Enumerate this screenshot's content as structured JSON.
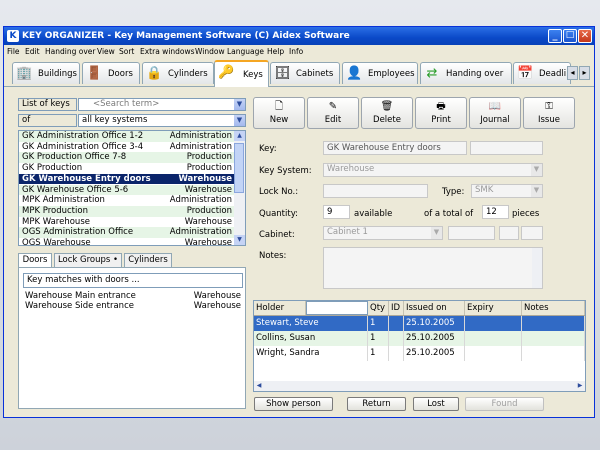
{
  "window": {
    "title": "KEY ORGANIZER  -  Key Management Software   (C) Aidex Software",
    "minimize": "_",
    "maximize": "□",
    "close": "✕"
  },
  "menu": [
    "File",
    "Edit",
    "Handing over",
    "View",
    "Sort",
    "Extra windows",
    "Window",
    "Language",
    "Help",
    "Info"
  ],
  "tabs": [
    {
      "label": "Buildings",
      "icon": "building-icon"
    },
    {
      "label": "Doors",
      "icon": "door-icon"
    },
    {
      "label": "Cylinders",
      "icon": "cylinder-icon"
    },
    {
      "label": "Keys",
      "icon": "key-icon"
    },
    {
      "label": "Cabinets",
      "icon": "cabinet-icon"
    },
    {
      "label": "Employees",
      "icon": "employee-icon"
    },
    {
      "label": "Handing over",
      "icon": "handover-icon"
    },
    {
      "label": "Deadli",
      "icon": "calendar-icon"
    }
  ],
  "active_tab": "Keys",
  "left": {
    "list_of_keys_label": "List of keys",
    "search_placeholder": "<Search term>",
    "of_label": "of",
    "key_system_filter": "all key systems",
    "keys": [
      {
        "name": "GK Administration Office 1-2",
        "system": "Administration"
      },
      {
        "name": "GK Administration Office 3-4",
        "system": "Administration"
      },
      {
        "name": "GK Production Office 7-8",
        "system": "Production"
      },
      {
        "name": "GK Production",
        "system": "Production"
      },
      {
        "name": "GK Warehouse Entry doors",
        "system": "Warehouse"
      },
      {
        "name": "GK Warehouse Office 5-6",
        "system": "Warehouse"
      },
      {
        "name": "MPK Administration",
        "system": "Administration"
      },
      {
        "name": "MPK Production",
        "system": "Production"
      },
      {
        "name": "MPK Warehouse",
        "system": "Warehouse"
      },
      {
        "name": "OGS Administration Office",
        "system": "Administration"
      },
      {
        "name": "OGS Warehouse",
        "system": "Warehouse"
      }
    ],
    "selected_key_index": 4,
    "subtabs": [
      "Doors",
      "Lock Groups •",
      "Cylinders"
    ],
    "door_search_placeholder": "Key matches with doors ...",
    "doors": [
      {
        "name": "Warehouse Main entrance",
        "system": "Warehouse"
      },
      {
        "name": "Warehouse Side entrance",
        "system": "Warehouse"
      }
    ]
  },
  "toolbar": {
    "new": "New",
    "edit": "Edit",
    "delete": "Delete",
    "print": "Print",
    "journal": "Journal",
    "issue": "Issue"
  },
  "form": {
    "key_label": "Key:",
    "key_value": "GK Warehouse Entry doors",
    "key_system_label": "Key System:",
    "key_system_value": "Warehouse",
    "lock_no_label": "Lock No.:",
    "lock_no_value": "",
    "type_label": "Type:",
    "type_value": "SMK",
    "quantity_label": "Quantity:",
    "quantity_value": "9",
    "available_label": "available",
    "total_label": "of a total of",
    "total_value": "12",
    "pieces_label": "pieces",
    "cabinet_label": "Cabinet:",
    "cabinet_value": "Cabinet 1",
    "notes_label": "Notes:"
  },
  "issued": {
    "columns": [
      "Holder",
      "Qty",
      "ID",
      "Issued on",
      "Expiry",
      "Notes"
    ],
    "rows": [
      {
        "holder": "Stewart, Steve",
        "qty": "1",
        "id": "",
        "issued_on": "25.10.2005",
        "expiry": "",
        "notes": ""
      },
      {
        "holder": "Collins, Susan",
        "qty": "1",
        "id": "",
        "issued_on": "25.10.2005",
        "expiry": "",
        "notes": ""
      },
      {
        "holder": "Wright, Sandra",
        "qty": "1",
        "id": "",
        "issued_on": "25.10.2005",
        "expiry": "",
        "notes": ""
      }
    ]
  },
  "bottom_buttons": {
    "show_person": "Show person",
    "return": "Return",
    "lost": "Lost",
    "found": "Found"
  },
  "colors": {
    "titlebar": "#0a49c8",
    "selection": "#0a246a",
    "grid_selection": "#316ac5",
    "alt_row": "#e6f5e6",
    "active_tab_accent": "#f5a623"
  }
}
